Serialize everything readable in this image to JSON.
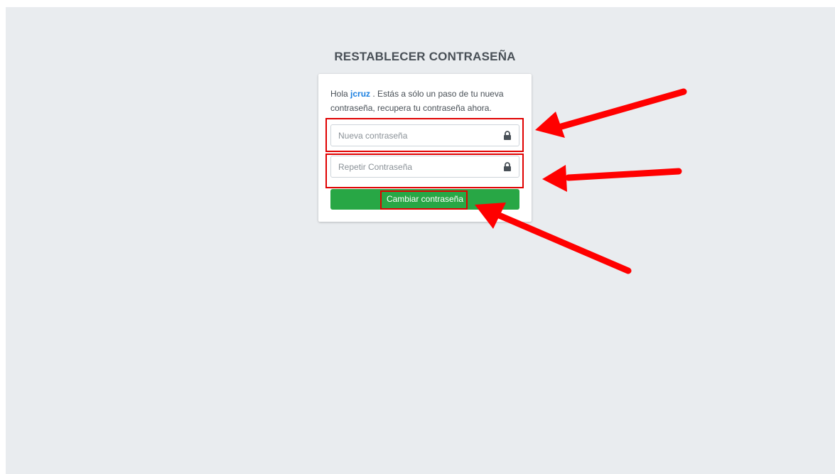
{
  "page": {
    "title": "RESTABLECER CONTRASEÑA"
  },
  "card": {
    "greeting_prefix": "Hola",
    "username": "jcruz",
    "greeting_suffix": ". Estás a sólo un paso de tu nueva contraseña, recupera tu contraseña ahora."
  },
  "form": {
    "new_password": {
      "value": "",
      "placeholder": "Nueva contraseña",
      "icon": "lock-icon"
    },
    "repeat_password": {
      "value": "",
      "placeholder": "Repetir Contraseña",
      "icon": "lock-icon"
    },
    "submit_label": "Cambiar contraseña"
  },
  "annotations": {
    "highlight_color": "#e00000",
    "arrow_color": "#ff0000"
  },
  "colors": {
    "background": "#e9ecef",
    "button": "#28a745",
    "link": "#1a7fe0"
  }
}
